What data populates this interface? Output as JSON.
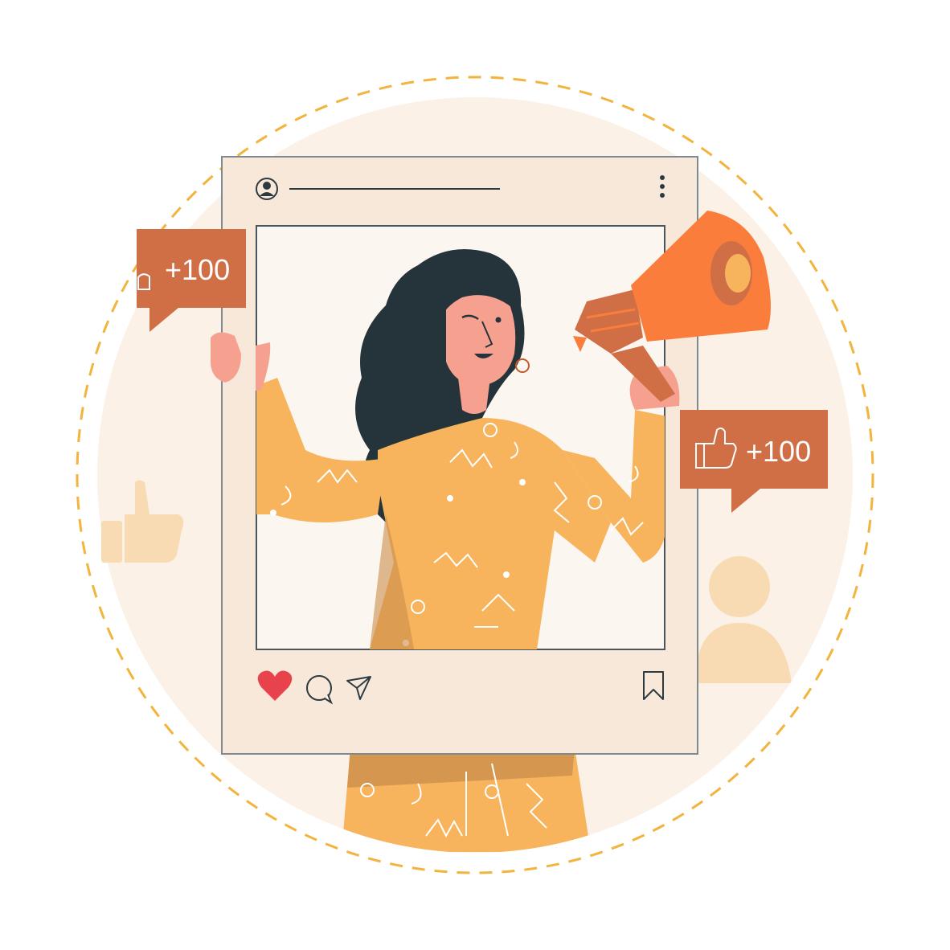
{
  "colors": {
    "background": "#ffffff",
    "circle_fill": "#fbf1e7",
    "dashed_ring": "#f2b43c",
    "post_frame": "#f8e8da",
    "photo_area": "#fcf6f1",
    "badge": "#d06f45",
    "sweater": "#f7b45c",
    "hair": "#25333a",
    "skin": "#f6a190",
    "megaphone": "#fb7d3c",
    "heart": "#e8424d",
    "outline": "#2d3a40",
    "faded_icons": "#f8dbb3"
  },
  "post": {
    "icons": {
      "avatar": "user-icon",
      "menu": "more-vertical-icon",
      "like": "heart-icon",
      "comment": "comment-icon",
      "share": "send-icon",
      "save": "bookmark-icon"
    }
  },
  "badges": {
    "left": {
      "text": "+100",
      "icon": "thumbs-up-icon"
    },
    "right": {
      "text": "+100",
      "icon": "thumbs-up-icon"
    }
  },
  "decor": {
    "faded_thumb": "thumbs-up-icon",
    "faded_user": "user-icon",
    "megaphone": "megaphone-icon"
  }
}
